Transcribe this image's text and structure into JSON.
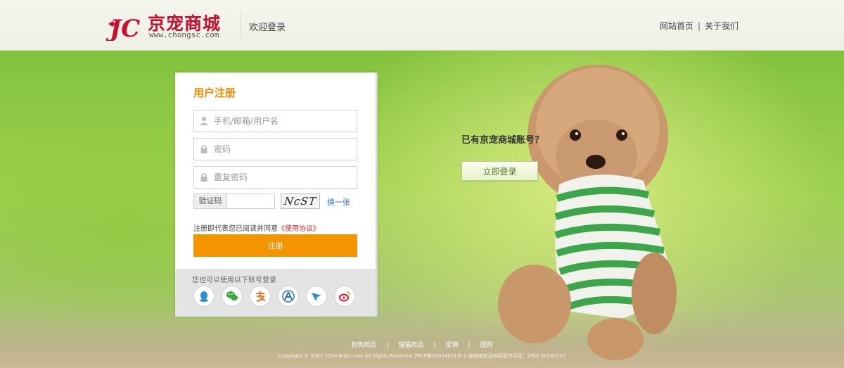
{
  "header": {
    "logo_text": "京宠商城",
    "logo_url": "www.chongsc.com",
    "welcome": "欢迎登录",
    "links": [
      "网站首页",
      "关于我们"
    ],
    "link_separator": "|"
  },
  "register": {
    "title": "用户注册",
    "fields": [
      {
        "placeholder": "手机/邮箱/用户名",
        "icon": "user-icon"
      },
      {
        "placeholder": "密码",
        "icon": "lock-icon"
      },
      {
        "placeholder": "重复密码",
        "icon": "lock-icon"
      }
    ],
    "captcha_label": "验证码",
    "captcha_text": "NcST",
    "captcha_refresh": "换一张",
    "agree_text": "注册即代表您已阅读并同意",
    "agree_link": "《使用协议》",
    "submit": "注册",
    "social_label": "您也可以使用以下账号登录",
    "social_icons": [
      "qq-icon",
      "wechat-icon",
      "alipay-icon",
      "baidu-icon",
      "tencent-weibo-icon",
      "sina-weibo-icon"
    ]
  },
  "login_prompt": {
    "question": "已有京宠商城账号？",
    "button": "立即登录"
  },
  "footer": {
    "nav": [
      "狗狗用品",
      "猫猫用品",
      "促销",
      "团购"
    ],
    "copyright": "Copyright © 2007-2014 B-pic.com All Rights Reserved 沪ICP备13024501号-2 增值电信业务经营许可证：沪B2-20140120"
  },
  "colors": {
    "brand_red": "#c8102e",
    "accent_orange": "#f39400",
    "title_orange": "#f08a00",
    "link_blue": "#2a6fbd"
  }
}
